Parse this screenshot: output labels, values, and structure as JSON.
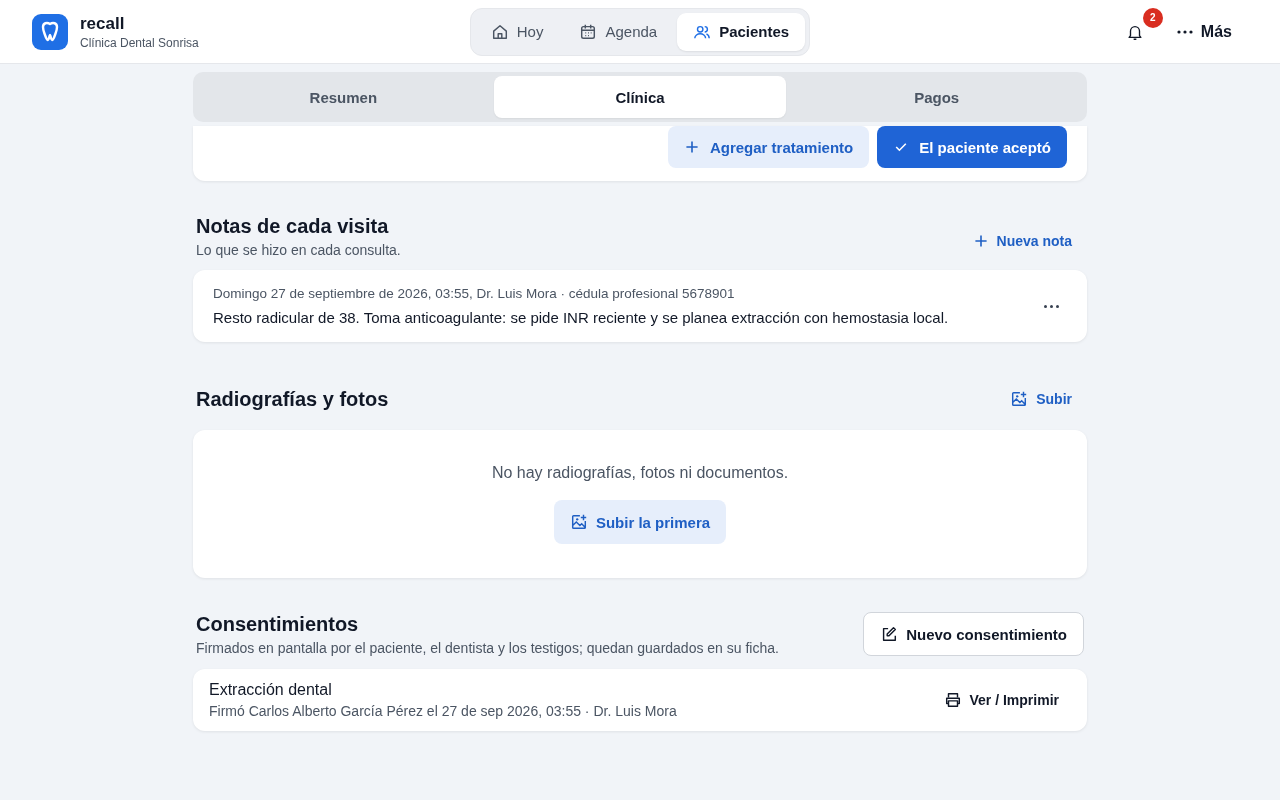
{
  "brand": {
    "name": "recall",
    "subtitle": "Clínica Dental Sonrisa"
  },
  "nav": [
    {
      "label": "Hoy",
      "selected": false
    },
    {
      "label": "Agenda",
      "selected": false
    },
    {
      "label": "Pacientes",
      "selected": true
    }
  ],
  "notifications": {
    "count": "2"
  },
  "more": {
    "label": "Más"
  },
  "tabs": [
    {
      "label": "Resumen",
      "selected": false
    },
    {
      "label": "Clínica",
      "selected": true
    },
    {
      "label": "Pagos",
      "selected": false
    }
  ],
  "treatment_actions": [
    {
      "label": "Agregar tratamiento",
      "kind": "secondary"
    },
    {
      "label": "El paciente aceptó",
      "kind": "primary"
    }
  ],
  "notes": {
    "title": "Notas de cada visita",
    "subtitle": "Lo que se hizo en cada consulta.",
    "action": "Nueva nota",
    "items": [
      {
        "meta": "Domingo 27 de septiembre de 2026, 03:55, Dr. Luis Mora · cédula profesional 5678901",
        "text": "Resto radicular de 38. Toma anticoagulante: se pide INR reciente y se planea extracción con hemostasia local."
      }
    ]
  },
  "images": {
    "title": "Radiografías y fotos",
    "action": "Subir",
    "empty": "No hay radiografías, fotos ni documentos.",
    "empty_action": "Subir la primera"
  },
  "consents": {
    "title": "Consentimientos",
    "subtitle": "Firmados en pantalla por el paciente, el dentista y los testigos; quedan guardados en su ficha.",
    "action": "Nuevo consentimiento",
    "items": [
      {
        "title": "Extracción dental",
        "detail": "Firmó Carlos Alberto García Pérez el 27 de sep 2026, 03:55 · Dr. Luis Mora",
        "action": "Ver / Imprimir"
      }
    ]
  }
}
